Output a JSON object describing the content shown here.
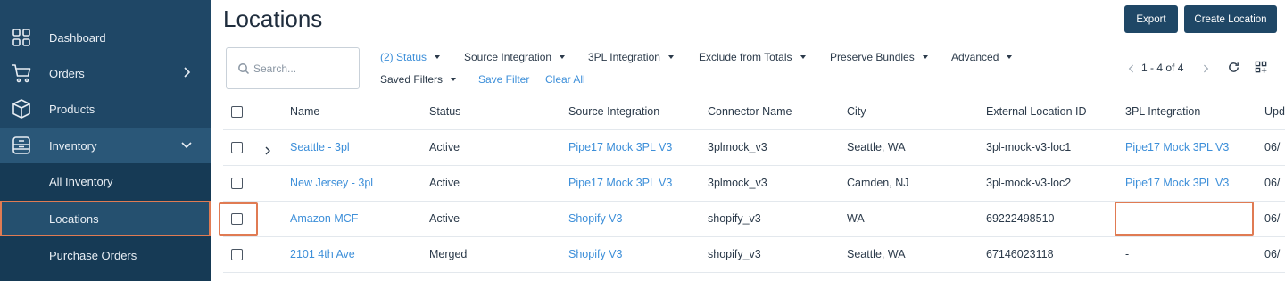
{
  "sidebar": {
    "items": [
      {
        "label": "Dashboard"
      },
      {
        "label": "Orders"
      },
      {
        "label": "Products"
      },
      {
        "label": "Inventory"
      }
    ],
    "sub_items": [
      {
        "label": "All Inventory"
      },
      {
        "label": "Locations"
      },
      {
        "label": "Purchase Orders"
      }
    ]
  },
  "header": {
    "title": "Locations",
    "export_label": "Export",
    "create_label": "Create Location"
  },
  "search": {
    "placeholder": "Search..."
  },
  "filters": {
    "status": "(2) Status",
    "source_integration": "Source Integration",
    "tpl_integration": "3PL Integration",
    "exclude": "Exclude from Totals",
    "preserve": "Preserve Bundles",
    "advanced": "Advanced",
    "saved_filters": "Saved Filters",
    "save_filter": "Save Filter",
    "clear_all": "Clear All"
  },
  "pager": {
    "range": "1 - 4 of 4"
  },
  "table": {
    "columns": [
      "Name",
      "Status",
      "Source Integration",
      "Connector Name",
      "City",
      "External Location ID",
      "3PL Integration",
      "Upd"
    ],
    "rows": [
      {
        "name": "Seattle - 3pl",
        "status": "Active",
        "source": "Pipe17 Mock 3PL V3",
        "connector": "3plmock_v3",
        "city": "Seattle, WA",
        "ext_id": "3pl-mock-v3-loc1",
        "tpl": "Pipe17 Mock 3PL V3",
        "updated": "06/"
      },
      {
        "name": "New Jersey - 3pl",
        "status": "Active",
        "source": "Pipe17 Mock 3PL V3",
        "connector": "3plmock_v3",
        "city": "Camden, NJ",
        "ext_id": "3pl-mock-v3-loc2",
        "tpl": "Pipe17 Mock 3PL V3",
        "updated": "06/"
      },
      {
        "name": "Amazon MCF",
        "status": "Active",
        "source": "Shopify V3",
        "connector": "shopify_v3",
        "city": "WA",
        "ext_id": "69222498510",
        "tpl": "-",
        "updated": "06/"
      },
      {
        "name": "2101 4th Ave",
        "status": "Merged",
        "source": "Shopify V3",
        "connector": "shopify_v3",
        "city": "Seattle, WA",
        "ext_id": "67146023118",
        "tpl": "-",
        "updated": "06/"
      }
    ]
  },
  "colors": {
    "sidebar": "#1f4766",
    "link": "#3d8fd9",
    "highlight": "#e07b53"
  }
}
